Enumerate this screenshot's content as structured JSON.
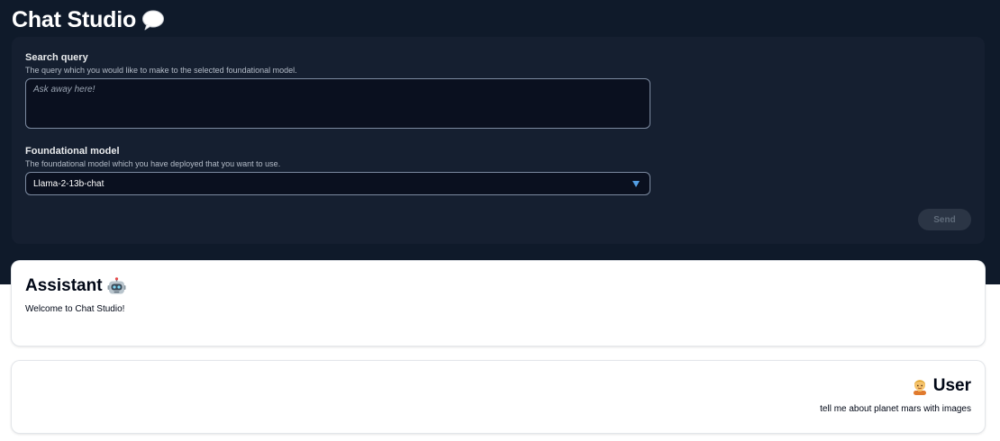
{
  "app": {
    "title": "Chat Studio",
    "title_icon": "speech-bubble-icon"
  },
  "form": {
    "query": {
      "label": "Search query",
      "description": "The query which you would like to make to the selected foundational model.",
      "value": "",
      "placeholder": "Ask away here!"
    },
    "model": {
      "label": "Foundational model",
      "description": "The foundational model which you have deployed that you want to use.",
      "selected": "Llama-2-13b-chat"
    },
    "send_label": "Send"
  },
  "messages": [
    {
      "role_label": "Assistant",
      "icon": "robot-icon",
      "text": "Welcome to Chat Studio!"
    },
    {
      "role_label": "User",
      "icon": "person-icon",
      "text": "tell me about planet mars with images"
    }
  ],
  "colors": {
    "background_dark": "#0f1a2a",
    "panel": "#151f30",
    "input_bg": "#0a101f",
    "caret": "#539fe5",
    "send_disabled_bg": "#2b3545",
    "send_disabled_text": "#5f6b7a"
  }
}
